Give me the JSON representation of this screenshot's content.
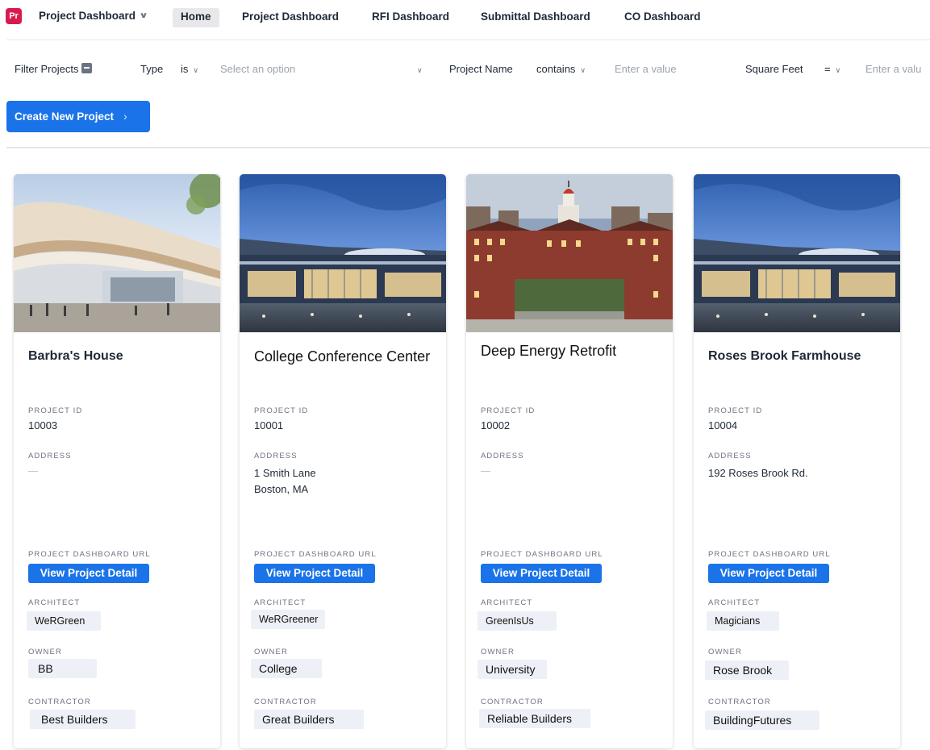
{
  "app": {
    "logo_text": "Pr",
    "switcher_label": "Project Dashboard",
    "brand_color": "#d81b4f",
    "accent_color": "#1a73e8"
  },
  "nav": {
    "tabs": [
      {
        "label": "Home",
        "active": true
      },
      {
        "label": "Project Dashboard",
        "active": false
      },
      {
        "label": "RFI Dashboard",
        "active": false
      },
      {
        "label": "Submittal Dashboard",
        "active": false
      },
      {
        "label": "CO Dashboard",
        "active": false
      }
    ]
  },
  "filters": {
    "title": "Filter Projects",
    "type": {
      "label": "Type",
      "operator": "is",
      "placeholder": "Select an option"
    },
    "project_name": {
      "label": "Project Name",
      "operator": "contains",
      "placeholder": "Enter a value"
    },
    "square_feet": {
      "label": "Square Feet",
      "operator": "=",
      "placeholder": "Enter a valu"
    }
  },
  "create_button": "Create New Project",
  "field_labels": {
    "project_id": "PROJECT ID",
    "address": "ADDRESS",
    "dashboard_url": "PROJECT DASHBOARD URL",
    "architect": "ARCHITECT",
    "owner": "OWNER",
    "contractor": "CONTRACTOR",
    "view_detail": "View Project Detail",
    "empty_value": "—"
  },
  "projects": [
    {
      "title": "Barbra's House",
      "project_id": "10003",
      "address_line1": "",
      "address_line2": "",
      "architect": "WeRGreen",
      "owner": "BB",
      "contractor": "Best Builders",
      "image": "modern-curved-building"
    },
    {
      "title": "College Conference Center",
      "project_id": "10001",
      "address_line1": "1 Smith Lane",
      "address_line2": "Boston, MA",
      "architect": "WeRGreener",
      "owner": "College",
      "contractor": "Great Builders",
      "image": "conference-center-dusk"
    },
    {
      "title": "Deep Energy Retrofit",
      "project_id": "10002",
      "address_line1": "",
      "address_line2": "",
      "architect": "GreenIsUs",
      "owner": "University",
      "contractor": "Reliable Builders",
      "image": "campus-brick-buildings"
    },
    {
      "title": "Roses Brook Farmhouse",
      "project_id": "10004",
      "address_line1": "192 Roses Brook Rd.",
      "address_line2": "",
      "architect": "Magicians",
      "owner": "Rose Brook",
      "contractor": "BuildingFutures",
      "image": "conference-center-dusk"
    }
  ]
}
